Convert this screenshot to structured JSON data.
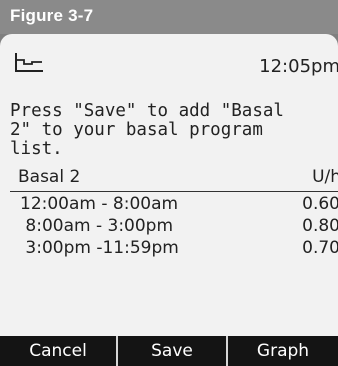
{
  "figure": {
    "label": "Figure 3-7"
  },
  "status": {
    "time": "12:05pm",
    "icon": "basal-step-graph-icon"
  },
  "message": {
    "text": "Press \"Save\" to add \"Basal\n2\" to your basal program\nlist."
  },
  "program": {
    "name": "Basal 2",
    "unit_header": "U/hr",
    "rows": [
      {
        "time_range": "12:00am - 8:00am",
        "rate": "0.60"
      },
      {
        "time_range": " 8:00am - 3:00pm",
        "rate": "0.80"
      },
      {
        "time_range": " 3:00pm -11:59pm",
        "rate": "0.70"
      }
    ]
  },
  "softkeys": {
    "left": "Cancel",
    "middle": "Save",
    "right": "Graph"
  },
  "colors": {
    "screen_bg": "#f2f2f2",
    "softkey_bar": "#141414",
    "figure_tab": "#8a8a8a"
  }
}
